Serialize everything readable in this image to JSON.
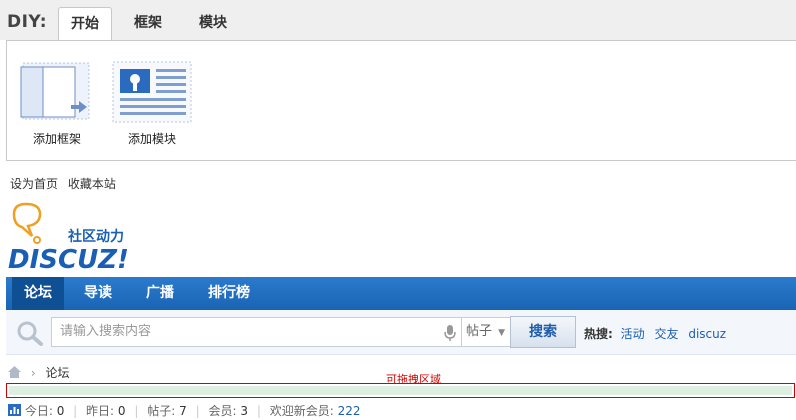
{
  "diy": {
    "title": "DIY:",
    "tabs": [
      "开始",
      "框架",
      "模块"
    ],
    "tools": [
      {
        "label": "添加框架"
      },
      {
        "label": "添加模块"
      }
    ]
  },
  "toplinks": [
    "设为首页",
    "收藏本站"
  ],
  "logo": {
    "tagline": "社区动力",
    "brand": "DISCUZ!"
  },
  "nav": [
    "论坛",
    "导读",
    "广播",
    "排行榜"
  ],
  "search": {
    "placeholder": "请输入搜索内容",
    "type": "帖子",
    "button": "搜索",
    "hot_label": "热搜:",
    "hot_words": [
      "活动",
      "交友",
      "discuz"
    ]
  },
  "breadcrumb": {
    "current": "论坛"
  },
  "drop_tip": "可拖拽区域",
  "stats": {
    "today_label": "今日:",
    "today": "0",
    "yesterday_label": "昨日:",
    "yesterday": "0",
    "posts_label": "帖子:",
    "posts": "7",
    "members_label": "会员:",
    "members": "3",
    "welcome_label": "欢迎新会员:",
    "newest": "222"
  },
  "colors": {
    "nav": "#1a64b4",
    "link": "#1a5fb4",
    "drop_border": "#d40000"
  }
}
